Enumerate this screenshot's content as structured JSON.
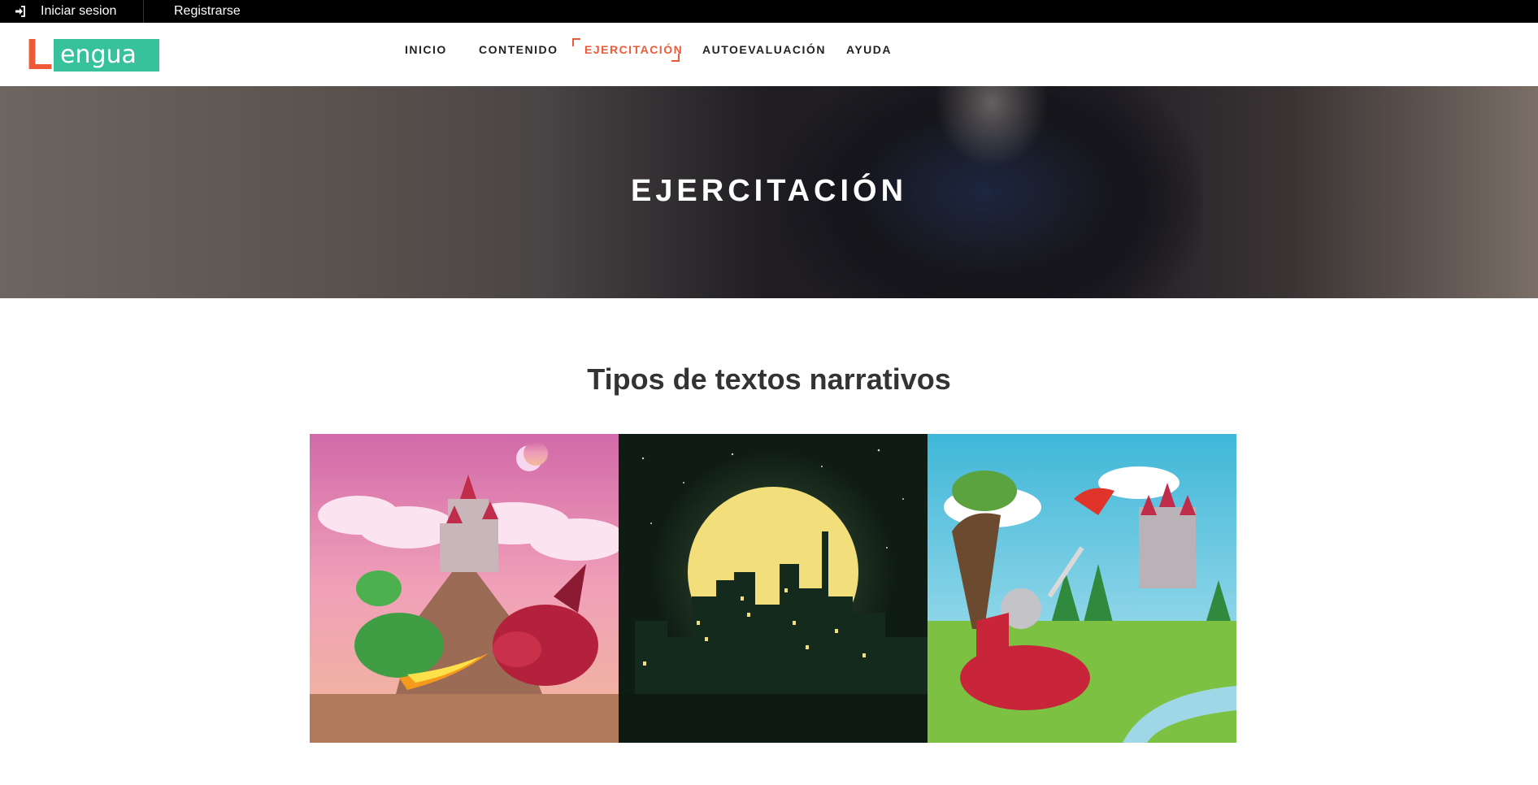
{
  "topbar": {
    "login_icon": "sign-in-icon",
    "login_label": "Iniciar sesion",
    "register_label": "Registrarse"
  },
  "logo": {
    "letter": "L",
    "text": "engua",
    "colors": {
      "letter": "#ee5a36",
      "box": "#37c29b"
    }
  },
  "nav": {
    "items": [
      {
        "label": "INICIO",
        "active": false
      },
      {
        "label": "CONTENIDO",
        "active": false
      },
      {
        "label": "EJERCITACIÓN",
        "active": true
      },
      {
        "label": "AUTOEVALUACIÓN",
        "active": false
      },
      {
        "label": "AYUDA",
        "active": false
      }
    ],
    "accent": "#ee5a36"
  },
  "hero": {
    "title": "EJERCITACIÓN"
  },
  "main": {
    "section_title": "Tipos de textos narrativos",
    "cards": [
      {
        "image": "dragons-castle-illustration"
      },
      {
        "image": "night-city-moon-illustration"
      },
      {
        "image": "knight-castle-dragon-illustration"
      }
    ]
  }
}
